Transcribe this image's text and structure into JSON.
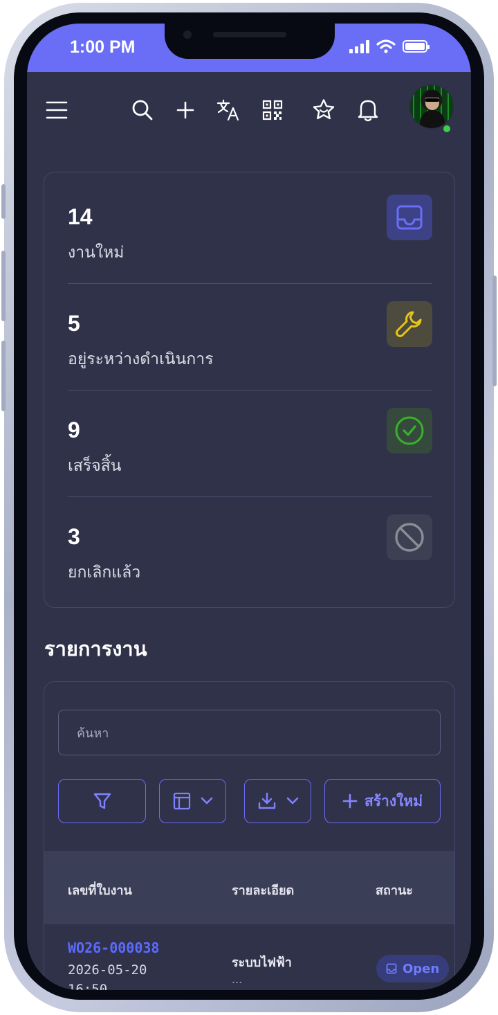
{
  "status_bar": {
    "time": "1:00 PM"
  },
  "toolbar": {
    "icons": [
      "menu-icon",
      "search-icon",
      "plus-icon",
      "translate-icon",
      "qr-code-icon",
      "favorites-icon",
      "bell-icon"
    ],
    "avatar_status_color": "#3ecf4a"
  },
  "stats": [
    {
      "count": "14",
      "label": "งานใหม่",
      "icon": "inbox-icon",
      "color": "#6a6df5"
    },
    {
      "count": "5",
      "label": "อยู่ระหว่างดำเนินการ",
      "icon": "wrench-icon",
      "color": "#e6c619"
    },
    {
      "count": "9",
      "label": "เสร็จสิ้น",
      "icon": "check-circle-icon",
      "color": "#38b12c"
    },
    {
      "count": "3",
      "label": "ยกเลิกแล้ว",
      "icon": "ban-icon",
      "color": "#8a8c96"
    }
  ],
  "work_list": {
    "title": "รายการงาน",
    "search_placeholder": "ค้นหา",
    "create_label": "สร้างใหม่",
    "columns": [
      "เลขที่ใบงาน",
      "รายละเอียด",
      "สถานะ"
    ],
    "rows": [
      {
        "id": "WO26-000038",
        "date": "2026-05-20",
        "time": "16:50",
        "detail": "ระบบไฟฟ้า",
        "detail_more": "...",
        "status": "Open"
      }
    ]
  },
  "colors": {
    "accent": "#6a6df5",
    "background": "#30324a"
  }
}
